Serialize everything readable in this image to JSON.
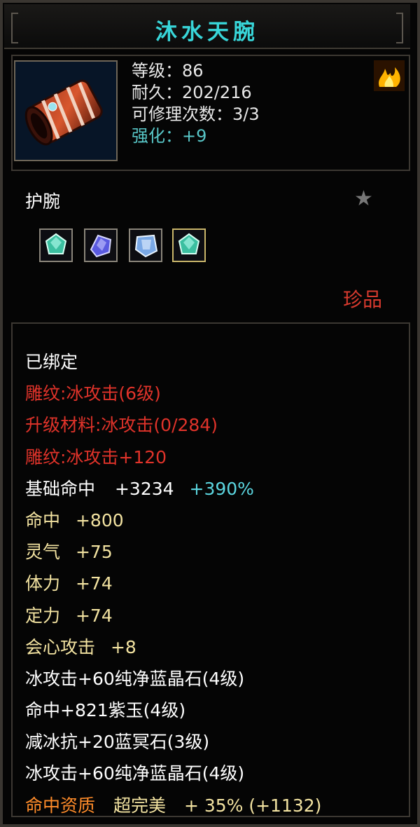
{
  "title": "沐水天腕",
  "item": {
    "level": "等级：86",
    "durability": "耐久：202/216",
    "repairs": "可修理次数：3/3",
    "enhance": "强化：+9",
    "type": "护腕",
    "rarity": "珍品",
    "icon": "bracer-icon",
    "badge_icon": "flame-icon",
    "star_icon": "star-icon"
  },
  "gems": [
    {
      "icon": "gem-icon",
      "color": "#3bbfa0"
    },
    {
      "icon": "gem-icon",
      "color": "#5a5ae0"
    },
    {
      "icon": "gem-icon",
      "color": "#7aa8e6"
    },
    {
      "icon": "gem-icon",
      "color": "#3bbfa0"
    }
  ],
  "bound": "已绑定",
  "engrave1": "雕纹:冰攻击(6级)",
  "upgrade_mat": "升级材料:冰攻击(0/284)",
  "engrave2": "雕纹:冰攻击+120",
  "base_hit": {
    "label": "基础命中",
    "value": "+3234",
    "bonus": "+390%"
  },
  "attrs": [
    {
      "label": "命中",
      "value": "+800"
    },
    {
      "label": "灵气",
      "value": "+75"
    },
    {
      "label": "体力",
      "value": "+74"
    },
    {
      "label": "定力",
      "value": "+74"
    },
    {
      "label": "会心攻击",
      "value": "+8"
    }
  ],
  "gem_lines": [
    "冰攻击+60纯净蓝晶石(4级)",
    "命中+821紫玉(4级)",
    "减冰抗+20蓝冥石(3级)",
    "冰攻击+60纯净蓝晶石(4级)"
  ],
  "quality": {
    "label": "命中资质",
    "grade": "超完美",
    "value": "+ 35% (+1132)"
  },
  "colors": {
    "title": "#38d6d9",
    "red": "#e0332a",
    "yellow": "#f3e3a1",
    "cyan": "#5bd6e0",
    "orange": "#ff8c2a"
  }
}
